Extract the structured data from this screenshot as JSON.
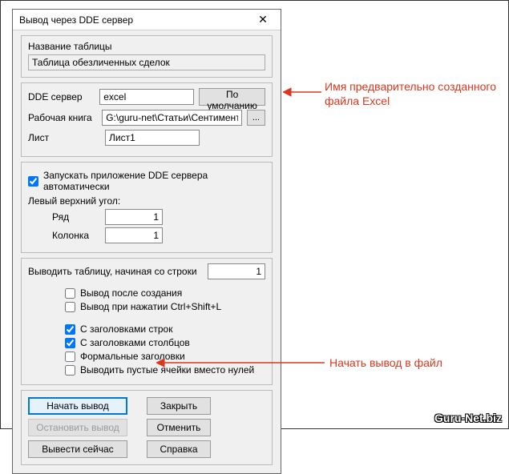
{
  "window": {
    "title": "Вывод через DDE сервер",
    "close_glyph": "✕"
  },
  "table_name": {
    "label": "Название таблицы",
    "value": "Таблица обезличенных сделок"
  },
  "server": {
    "dde_label": "DDE сервер",
    "dde_value": "excel",
    "default_btn": "По умолчанию",
    "workbook_label": "Рабочая книга",
    "workbook_value": "G:\\guru-net\\Статьи\\Сентимент\\I",
    "browse_btn": "...",
    "sheet_label": "Лист",
    "sheet_value": "Лист1"
  },
  "autostart": {
    "checked": true,
    "label": "Запускать приложение DDE сервера автоматически"
  },
  "corner": {
    "title": "Левый верхний угол:",
    "row_label": "Ряд",
    "row_value": "1",
    "col_label": "Колонка",
    "col_value": "1"
  },
  "output": {
    "start_row_label": "Выводить таблицу,  начиная со строки",
    "start_row_value": "1",
    "options": [
      {
        "checked": false,
        "label": "Вывод после создания"
      },
      {
        "checked": false,
        "label": "Вывод при нажатии Ctrl+Shift+L"
      },
      {
        "checked": true,
        "label": "С заголовками строк"
      },
      {
        "checked": true,
        "label": "С заголовками столбцов"
      },
      {
        "checked": false,
        "label": "Формальные заголовки"
      },
      {
        "checked": false,
        "label": "Выводить пустые ячейки вместо нулей"
      }
    ]
  },
  "buttons": {
    "start": "Начать вывод",
    "stop": "Остановить вывод",
    "now": "Вывести сейчас",
    "close": "Закрыть",
    "cancel": "Отменить",
    "help": "Справка"
  },
  "annotations": {
    "a1_line1": "Имя предварительно созданного",
    "a1_line2": "файла Excel",
    "a2": "Начать вывод в файл"
  },
  "watermark": "Guru-Net.biz"
}
